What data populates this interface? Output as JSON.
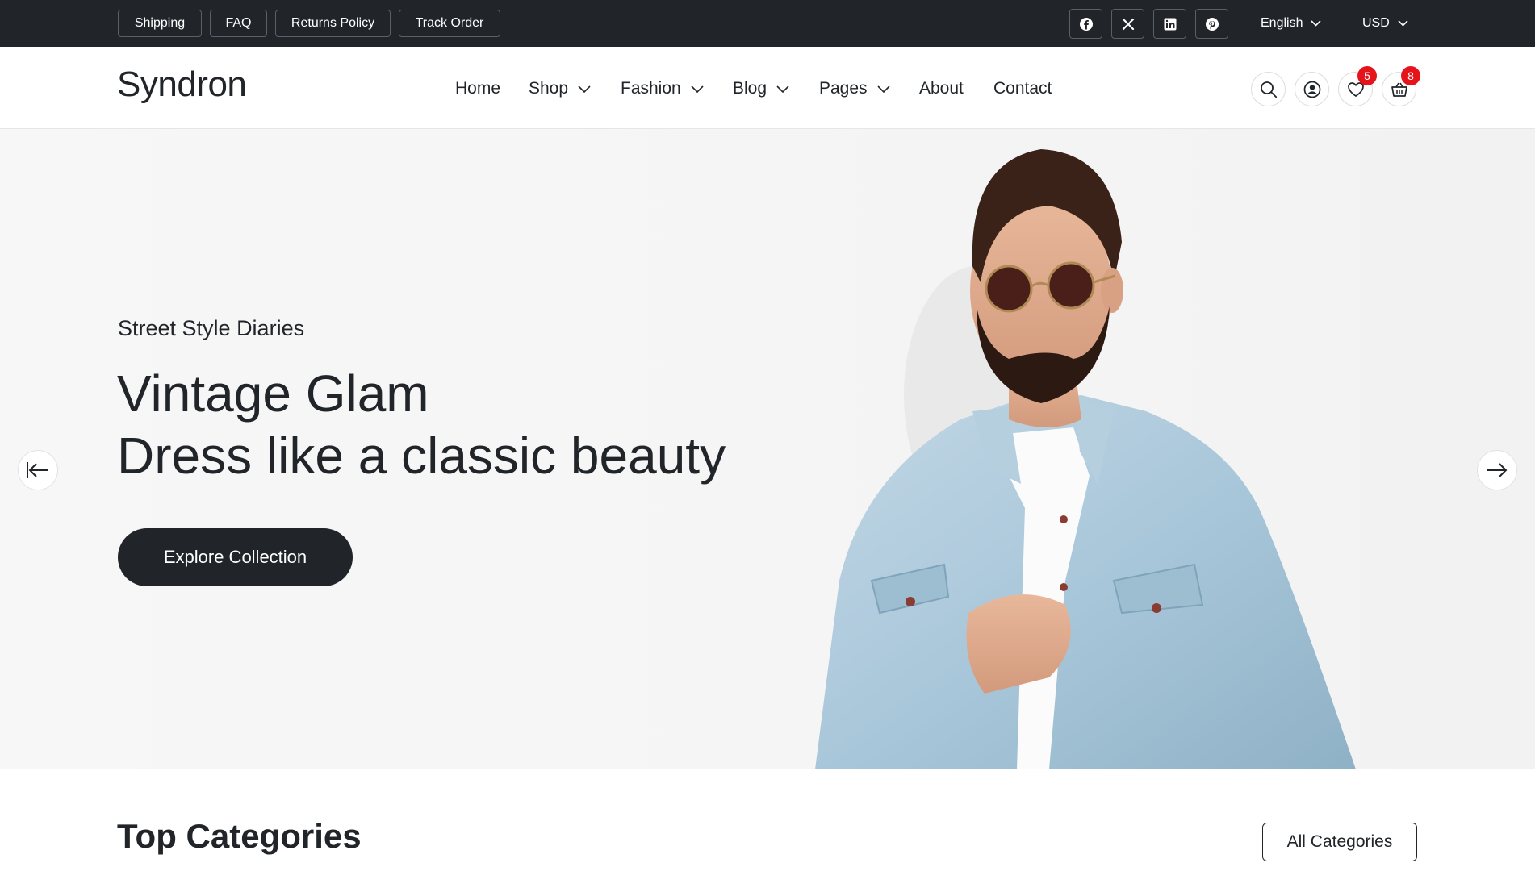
{
  "topbar": {
    "links": [
      {
        "label": "Shipping"
      },
      {
        "label": "FAQ"
      },
      {
        "label": "Returns Policy"
      },
      {
        "label": "Track Order"
      }
    ],
    "social_icons": [
      "facebook-icon",
      "x-twitter-icon",
      "linkedin-icon",
      "pinterest-icon"
    ],
    "language": "English",
    "currency": "USD"
  },
  "header": {
    "logo": "Syndron",
    "nav": [
      {
        "label": "Home",
        "has_dropdown": false
      },
      {
        "label": "Shop",
        "has_dropdown": true
      },
      {
        "label": "Fashion",
        "has_dropdown": true
      },
      {
        "label": "Blog",
        "has_dropdown": true
      },
      {
        "label": "Pages",
        "has_dropdown": true
      },
      {
        "label": "About",
        "has_dropdown": false
      },
      {
        "label": "Contact",
        "has_dropdown": false
      }
    ],
    "icons": {
      "search": "search-icon",
      "account": "user-icon",
      "wishlist": "heart-icon",
      "wishlist_count": "5",
      "cart": "basket-icon",
      "cart_count": "8"
    }
  },
  "hero": {
    "subtitle": "Street Style Diaries",
    "title_line1": "Vintage Glam",
    "title_line2": "Dress like a classic beauty",
    "cta": "Explore Collection",
    "prev_icon": "arrow-left-icon",
    "next_icon": "arrow-right-icon"
  },
  "categories": {
    "title": "Top Categories",
    "all_button": "All Categories"
  },
  "colors": {
    "dark": "#212529",
    "badge": "#e5141a",
    "denim": "#a9c7da",
    "hero_bg": "#f6f6f6"
  }
}
